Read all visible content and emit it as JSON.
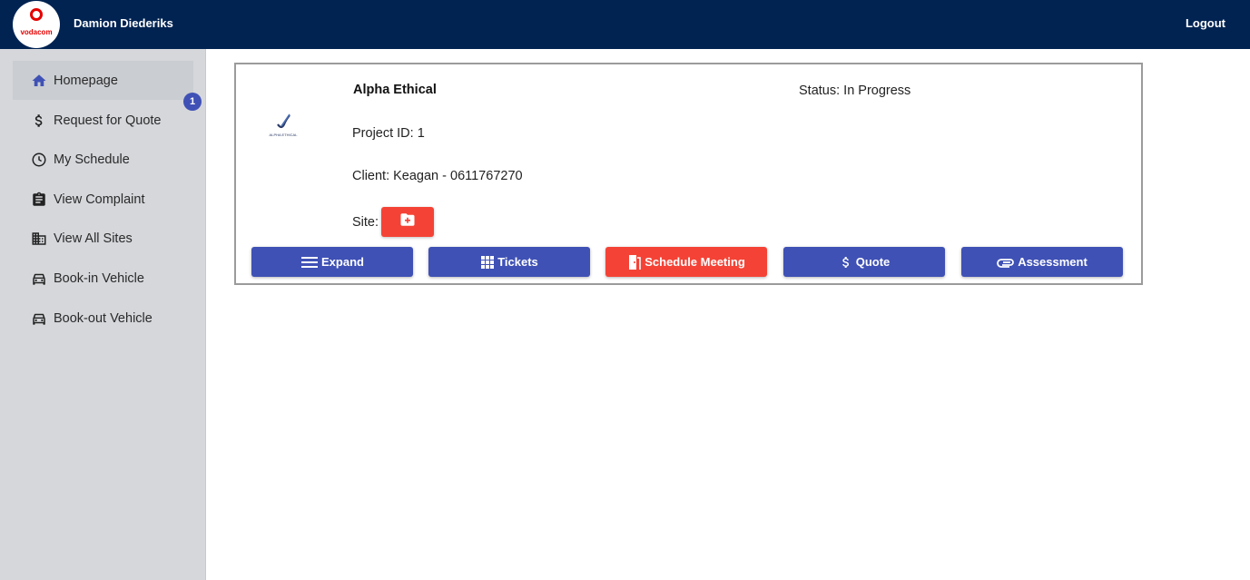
{
  "header": {
    "logo_text": "vodacom",
    "user_name": "Damion Diederiks",
    "logout_label": "Logout"
  },
  "sidebar": {
    "badge_count": "1",
    "items": [
      {
        "label": "Homepage",
        "icon": "home-icon"
      },
      {
        "label": "Request for Quote",
        "icon": "dollar-icon"
      },
      {
        "label": "My Schedule",
        "icon": "clock-icon"
      },
      {
        "label": "View Complaint",
        "icon": "clipboard-icon"
      },
      {
        "label": "View All Sites",
        "icon": "building-icon"
      },
      {
        "label": "Book-in Vehicle",
        "icon": "car-icon"
      },
      {
        "label": "Book-out Vehicle",
        "icon": "car-icon"
      }
    ]
  },
  "project": {
    "logo_text": "ALPHA ETHICAL",
    "name": "Alpha Ethical",
    "status": "Status: In Progress",
    "project_id": "Project ID: 1",
    "client": "Client: Keagan - 0611767270",
    "site_label": "Site:"
  },
  "actions": {
    "expand": "Expand",
    "tickets": "Tickets",
    "schedule_meeting": "Schedule Meeting",
    "quote": "Quote",
    "assessment": "Assessment"
  },
  "colors": {
    "header_bg": "#002352",
    "primary": "#3f51b5",
    "danger": "#f44336",
    "sidebar_bg": "#d5d7db"
  }
}
